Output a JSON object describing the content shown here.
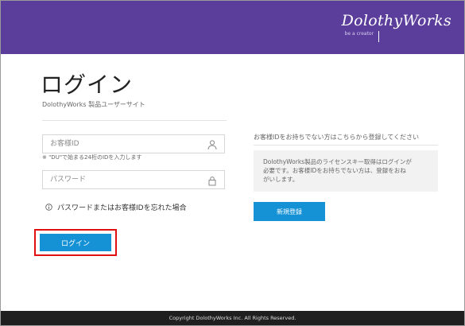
{
  "header": {
    "brand_name": "DolothyWorks",
    "brand_tagline": "be a creator",
    "background_color": "#5b3d9b"
  },
  "login": {
    "title": "ログイン",
    "subtitle": "DolothyWorks 製品ユーザーサイト",
    "customer_id_placeholder": "お客様ID",
    "customer_id_value": "",
    "customer_id_hint": "※ \"DU\"で始まる24桁のIDを入力します",
    "password_placeholder": "パスワード",
    "password_value": "",
    "forgot_link": "パスワードまたはお客様IDを忘れた場合",
    "login_button": "ログイン",
    "user_icon": "user-icon",
    "lock_icon": "lock-icon",
    "info_icon": "info-icon"
  },
  "register": {
    "note": "お客様IDをお持ちでない方はこちらから登録してください",
    "info_text_line1": "DolothyWorks製品のライセンスキー取得はログインが",
    "info_text_line2": "必要です。お客様IDをお持ちでない方は、登録をおね",
    "info_text_line3": "がいします。",
    "register_button": "新規登録"
  },
  "footer": {
    "copyright": "Copyright DolothyWorks Inc. All Rights Reserved."
  },
  "colors": {
    "accent_blue": "#1592d6",
    "highlight_red": "#e01010",
    "footer_bg": "#1f1f1f"
  }
}
